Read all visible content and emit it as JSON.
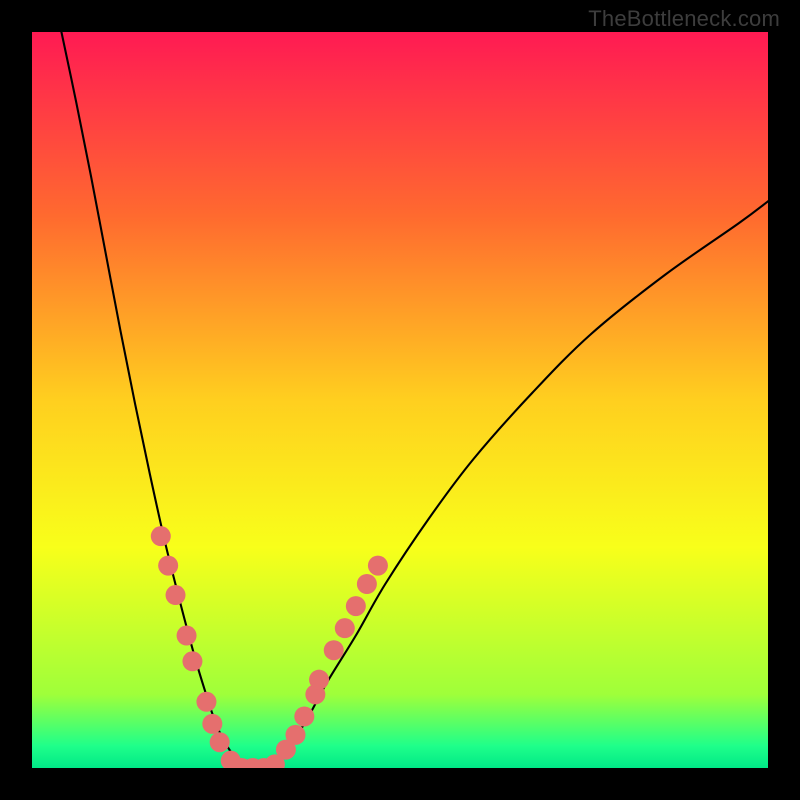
{
  "watermark": "TheBottleneck.com",
  "chart_data": {
    "type": "line",
    "title": "",
    "xlabel": "",
    "ylabel": "",
    "xlim": [
      0,
      100
    ],
    "ylim": [
      0,
      100
    ],
    "grid": false,
    "legend": false,
    "background_gradient": {
      "stops": [
        {
          "offset": 0.0,
          "color": "#ff1a53"
        },
        {
          "offset": 0.25,
          "color": "#ff6a2f"
        },
        {
          "offset": 0.5,
          "color": "#ffcf1f"
        },
        {
          "offset": 0.7,
          "color": "#f8ff1a"
        },
        {
          "offset": 0.9,
          "color": "#9fff3a"
        },
        {
          "offset": 0.97,
          "color": "#1fff8a"
        },
        {
          "offset": 1.0,
          "color": "#00e887"
        }
      ]
    },
    "curve": {
      "description": "V-shaped bottleneck curve (asymmetric, steeper left branch)",
      "x": [
        4,
        6,
        8,
        10,
        12,
        14,
        16,
        18,
        20,
        22,
        23.5,
        25,
        26.5,
        28,
        29.5,
        31,
        34,
        37,
        40,
        44,
        48,
        54,
        60,
        68,
        76,
        86,
        96,
        100
      ],
      "y": [
        100,
        90.5,
        80.5,
        70,
        59.5,
        49.5,
        40,
        31,
        23,
        15.5,
        10.5,
        6,
        3,
        1,
        0,
        0,
        2,
        6,
        11.5,
        18,
        25,
        34,
        42,
        51,
        59,
        67,
        74,
        77
      ]
    },
    "marker_series": {
      "description": "pink-red dots clustered along the lower branches of the V",
      "color": "#e56f6e",
      "radius_px": 10,
      "points": [
        {
          "x": 17.5,
          "y": 31.5
        },
        {
          "x": 18.5,
          "y": 27.5
        },
        {
          "x": 19.5,
          "y": 23.5
        },
        {
          "x": 21.0,
          "y": 18.0
        },
        {
          "x": 21.8,
          "y": 14.5
        },
        {
          "x": 23.7,
          "y": 9.0
        },
        {
          "x": 24.5,
          "y": 6.0
        },
        {
          "x": 25.5,
          "y": 3.5
        },
        {
          "x": 27.0,
          "y": 1.0
        },
        {
          "x": 28.5,
          "y": 0.0
        },
        {
          "x": 30.0,
          "y": 0.0
        },
        {
          "x": 31.5,
          "y": 0.0
        },
        {
          "x": 33.0,
          "y": 0.5
        },
        {
          "x": 34.5,
          "y": 2.5
        },
        {
          "x": 35.8,
          "y": 4.5
        },
        {
          "x": 37.0,
          "y": 7.0
        },
        {
          "x": 38.5,
          "y": 10.0
        },
        {
          "x": 39.0,
          "y": 12.0
        },
        {
          "x": 41.0,
          "y": 16.0
        },
        {
          "x": 42.5,
          "y": 19.0
        },
        {
          "x": 44.0,
          "y": 22.0
        },
        {
          "x": 45.5,
          "y": 25.0
        },
        {
          "x": 47.0,
          "y": 27.5
        }
      ]
    }
  }
}
